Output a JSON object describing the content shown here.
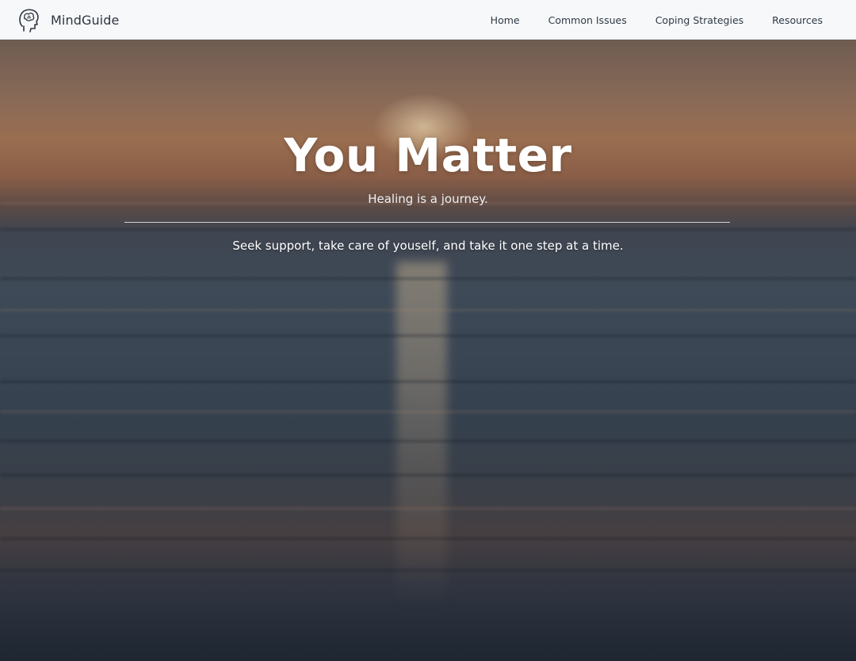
{
  "brand": {
    "name": "MindGuide",
    "icon": "head-brain-icon"
  },
  "nav": {
    "items": [
      {
        "label": "Home"
      },
      {
        "label": "Common Issues"
      },
      {
        "label": "Coping Strategies"
      },
      {
        "label": "Resources"
      }
    ]
  },
  "hero": {
    "title": "You Matter",
    "subtitle": "Healing is a journey.",
    "tagline": "Seek support, take care of youself, and take it one step at a time.",
    "background": "ocean-sunset-image"
  },
  "colors": {
    "navbar_bg": "#f7f8fa",
    "nav_text": "#2e3a46",
    "hero_text": "#ffffff"
  }
}
